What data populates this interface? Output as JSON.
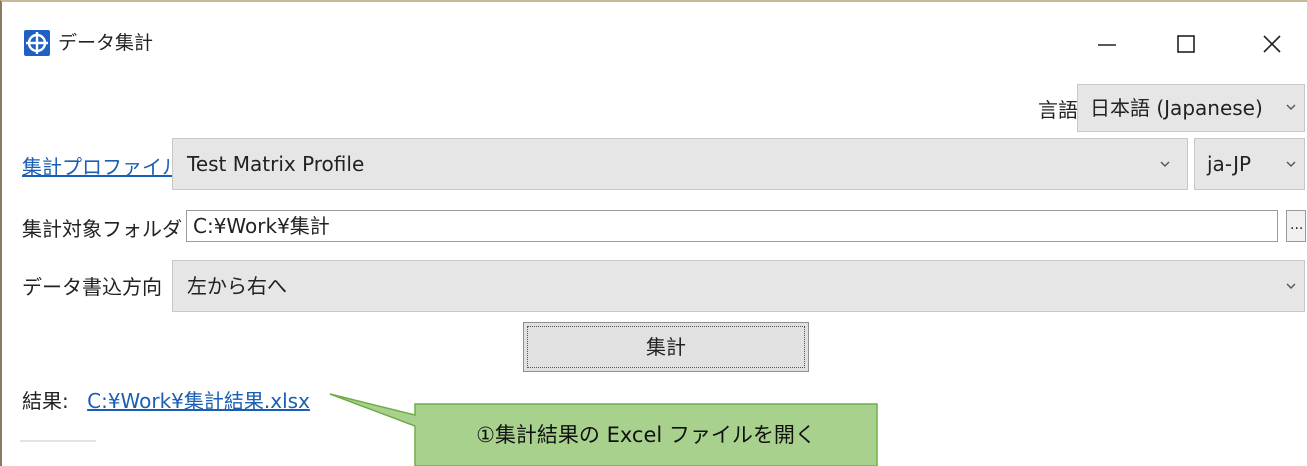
{
  "window": {
    "title": "データ集計",
    "controls": {
      "minimize": "—",
      "maximize": "☐",
      "close": "✕"
    }
  },
  "language": {
    "label": "言語",
    "selected": "日本語 (Japanese)"
  },
  "profile": {
    "link_label": "集計プロファイル",
    "selected": "Test Matrix Profile",
    "culture": "ja-JP"
  },
  "folder": {
    "label": "集計対象フォルダ",
    "value": "C:¥Work¥集計",
    "browse_label": "..."
  },
  "direction": {
    "label": "データ書込方向",
    "selected": "左から右へ"
  },
  "run_button": {
    "label": "集計"
  },
  "result": {
    "label": "結果:",
    "link": "C:¥Work¥集計結果.xlsx"
  },
  "callout": {
    "text": "①集計結果の Excel ファイルを開く",
    "fill": "#a9d18e",
    "stroke": "#70ad47"
  },
  "colors": {
    "link": "#1a5fb4",
    "combo_bg": "#e6e6e6",
    "app_icon": "#1f5fc6"
  },
  "icons": {
    "app": "crosshair-icon",
    "dropdown": "chevron-down-icon"
  }
}
